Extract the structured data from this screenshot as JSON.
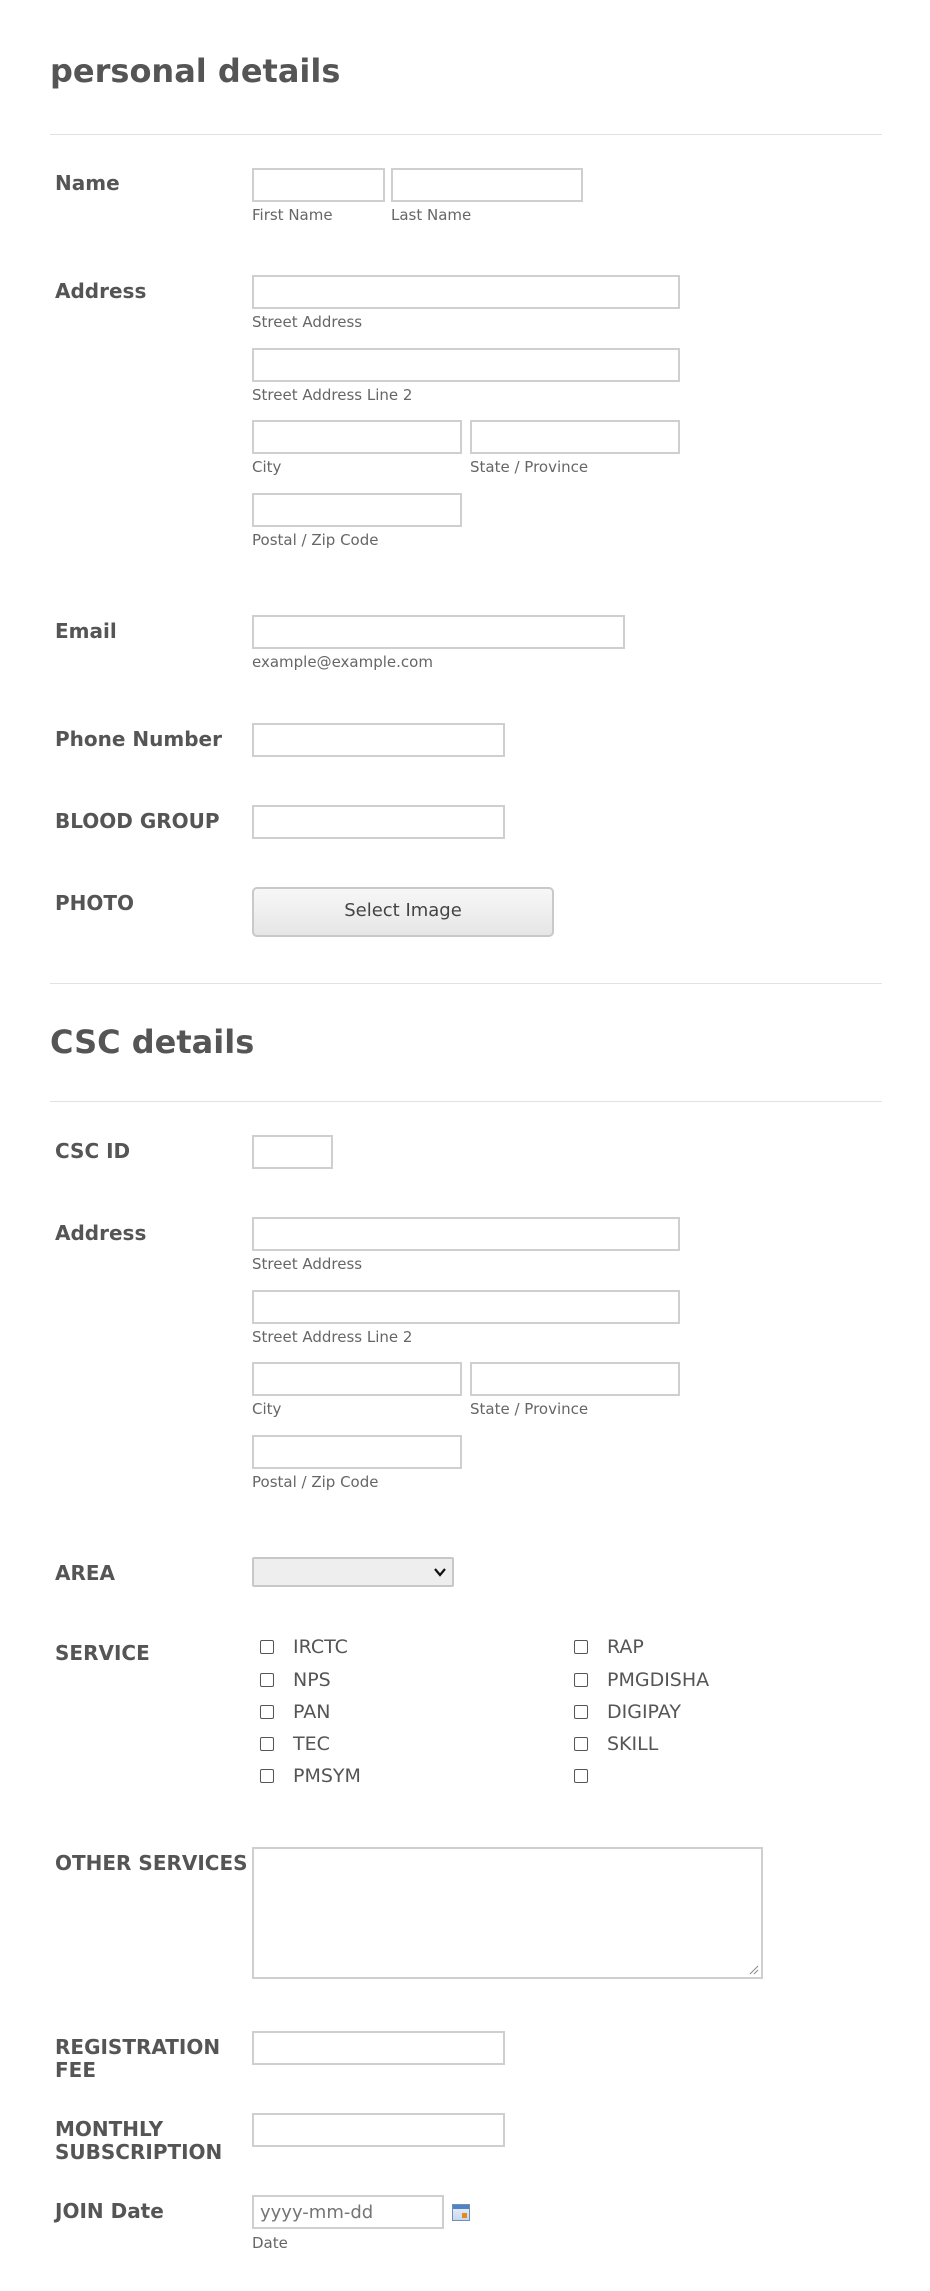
{
  "personal": {
    "title": "personal details",
    "name_label": "Name",
    "first_name_sub": "First Name",
    "last_name_sub": "Last Name",
    "address_label": "Address",
    "street_sub": "Street Address",
    "street2_sub": "Street Address Line 2",
    "city_sub": "City",
    "state_sub": "State / Province",
    "postal_sub": "Postal / Zip Code",
    "email_label": "Email",
    "email_sub": "example@example.com",
    "phone_label": "Phone Number",
    "blood_label": "BLOOD GROUP",
    "photo_label": "PHOTO",
    "select_image_button": "Select Image"
  },
  "csc": {
    "title": "CSC details",
    "id_label": "CSC ID",
    "address_label": "Address",
    "street_sub": "Street Address",
    "street2_sub": "Street Address Line 2",
    "city_sub": "City",
    "state_sub": "State / Province",
    "postal_sub": "Postal / Zip Code",
    "area_label": "AREA",
    "area_selected": "",
    "service_label": "SERVICE",
    "services_left": [
      "IRCTC",
      "NPS",
      "PAN",
      "TEC",
      "PMSYM"
    ],
    "services_right": [
      "RAP",
      "PMGDISHA",
      "DIGIPAY",
      "SKILL",
      ""
    ],
    "other_services_label": "OTHER SERVICES",
    "registration_fee_label": "REGISTRATION FEE",
    "monthly_subscription_label": "MONTHLY SUBSCRIPTION",
    "join_date_label": "JOIN Date",
    "join_date_placeholder": "yyyy-mm-dd",
    "join_date_sub": "Date"
  },
  "icons": {
    "calendar": "calendar-icon",
    "dropdown": "chevron-down-icon"
  },
  "colors": {
    "text": "#555555",
    "border": "#cfcfcf",
    "divider": "#e2e2e2"
  }
}
